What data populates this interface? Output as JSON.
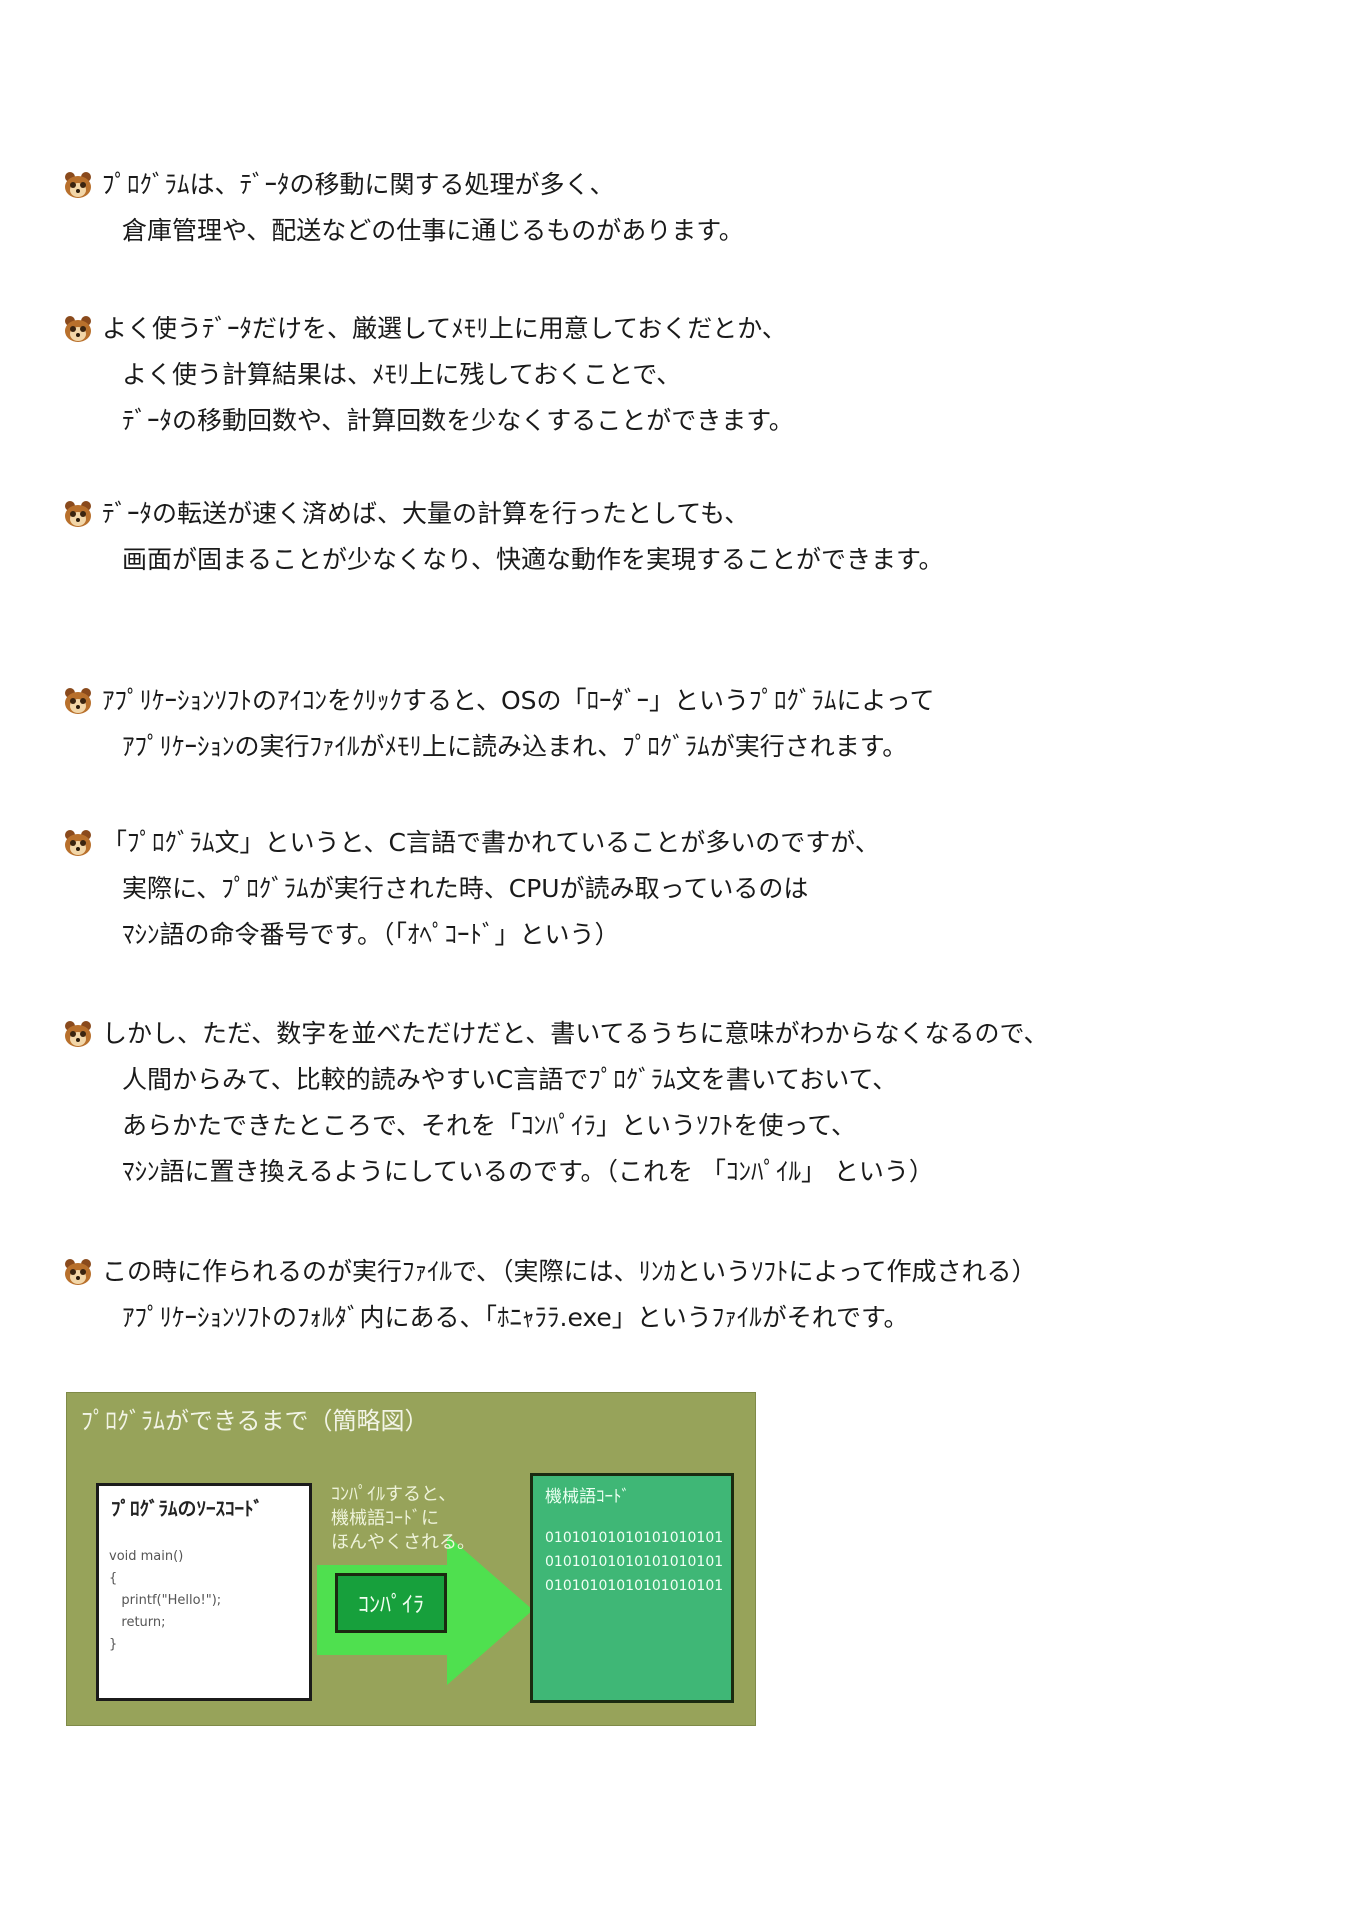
{
  "paragraphs": [
    {
      "lines": [
        "ﾌﾟﾛｸﾞﾗﾑは、ﾃﾞｰﾀの移動に関する処理が多く、",
        "倉庫管理や、配送などの仕事に通じるものがあります。"
      ]
    },
    {
      "lines": [
        "よく使うﾃﾞｰﾀだけを、厳選してﾒﾓﾘ上に用意しておくだとか、",
        "よく使う計算結果は、ﾒﾓﾘ上に残しておくことで、",
        "ﾃﾞｰﾀの移動回数や、計算回数を少なくすることができます。"
      ]
    },
    {
      "lines": [
        "ﾃﾞｰﾀの転送が速く済めば、大量の計算を行ったとしても、",
        "画面が固まることが少なくなり、快適な動作を実現することができます。"
      ]
    },
    {
      "lines": [
        "ｱﾌﾟﾘｹｰｼｮﾝｿﾌﾄのｱｲｺﾝをｸﾘｯｸすると、OSの「ﾛｰﾀﾞｰ」というﾌﾟﾛｸﾞﾗﾑによって",
        "ｱﾌﾟﾘｹｰｼｮﾝの実行ﾌｧｲﾙがﾒﾓﾘ上に読み込まれ、ﾌﾟﾛｸﾞﾗﾑが実行されます。"
      ]
    },
    {
      "lines": [
        "「ﾌﾟﾛｸﾞﾗﾑ文」というと、C言語で書かれていることが多いのですが、",
        "実際に、ﾌﾟﾛｸﾞﾗﾑが実行された時、CPUが読み取っているのは",
        "ﾏｼﾝ語の命令番号です。（「ｵﾍﾟｺｰﾄﾞ」という）"
      ]
    },
    {
      "lines": [
        "しかし、ただ、数字を並べただけだと、書いてるうちに意味がわからなくなるので、",
        "人間からみて、比較的読みやすいC言語でﾌﾟﾛｸﾞﾗﾑ文を書いておいて、",
        "あらかたできたところで、それを「ｺﾝﾊﾟｲﾗ」というｿﾌﾄを使って、",
        "ﾏｼﾝ語に置き換えるようにしているのです。（これを 「ｺﾝﾊﾟｲﾙ」 という）"
      ]
    },
    {
      "lines": [
        "この時に作られるのが実行ﾌｧｲﾙで、（実際には、ﾘﾝｶというｿﾌﾄによって作成される）",
        "ｱﾌﾟﾘｹｰｼｮﾝｿﾌﾄのﾌｫﾙﾀﾞ内にある、「ﾎﾆｬﾗﾗ.exe」というﾌｧｲﾙがそれです。"
      ]
    }
  ],
  "figure": {
    "title": "ﾌﾟﾛｸﾞﾗﾑができるまで（簡略図）",
    "source_box_title": "ﾌﾟﾛｸﾞﾗﾑのｿｰｽｺｰﾄﾞ",
    "code": "void main()\n{\n   printf(\"Hello!\");\n   return;\n}",
    "arrow_note": "ｺﾝﾊﾟｲﾙすると、\n機械語ｺｰﾄﾞに\nほんやくされる。",
    "compile_button": "ｺﾝﾊﾟｲﾗ",
    "machine_box_title": "機械語ｺｰﾄﾞ",
    "binary": "01010101010101010101\n01010101010101010101\n01010101010101010101"
  },
  "colors": {
    "figure_bg": "#97a35a",
    "arrow": "#4fe04f",
    "machine_box": "#3fb776",
    "compile_button": "#17a03c"
  },
  "icons": {
    "bullet": "tanuki-face-icon"
  }
}
